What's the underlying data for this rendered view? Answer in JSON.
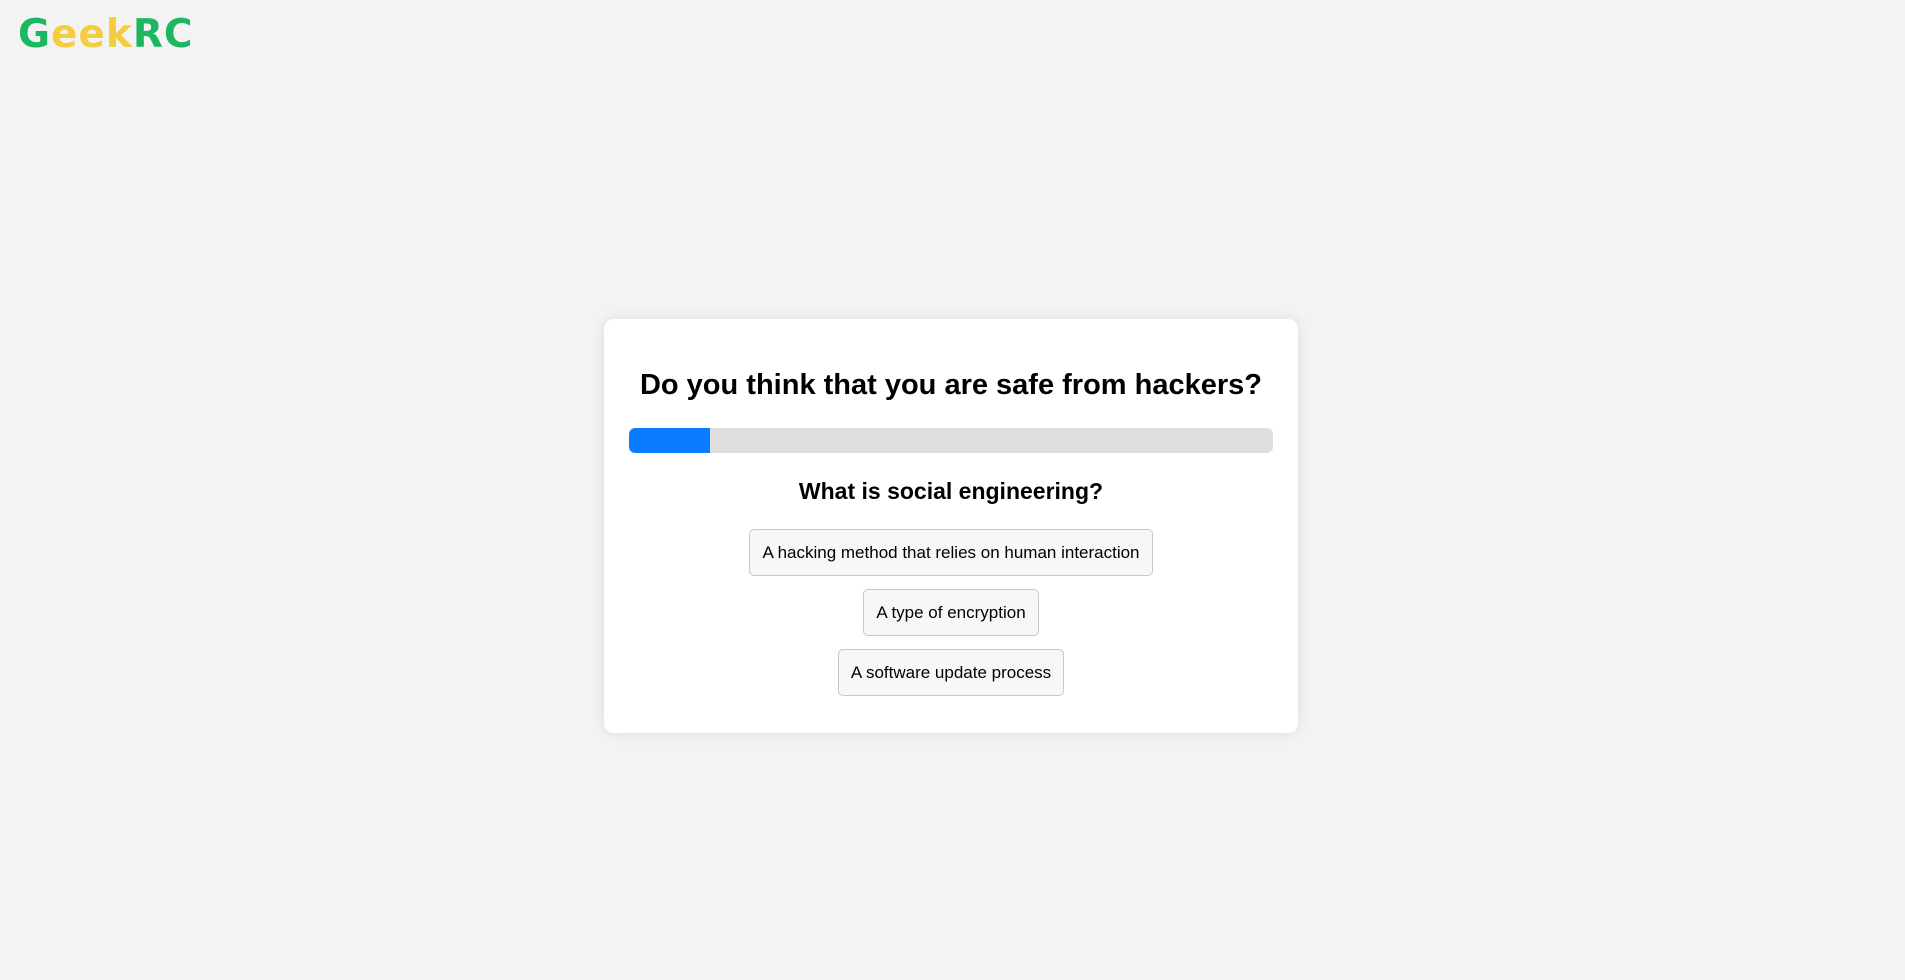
{
  "brand": {
    "letters": [
      {
        "char": "G",
        "color": "#1cb760"
      },
      {
        "char": "e",
        "color": "#f5cd3c"
      },
      {
        "char": "e",
        "color": "#f5cd3c"
      },
      {
        "char": "k",
        "color": "#f5cd3c"
      },
      {
        "char": "R",
        "color": "#1cb760"
      },
      {
        "char": "C",
        "color": "#1cb760"
      }
    ]
  },
  "quiz": {
    "title": "Do you think that you are safe from hackers?",
    "progress_fraction": 0.125,
    "progress_color": "#0a7cff",
    "question": "What is social engineering?",
    "answers": [
      "A hacking method that relies on human interaction",
      "A type of encryption",
      "A software update process"
    ]
  }
}
